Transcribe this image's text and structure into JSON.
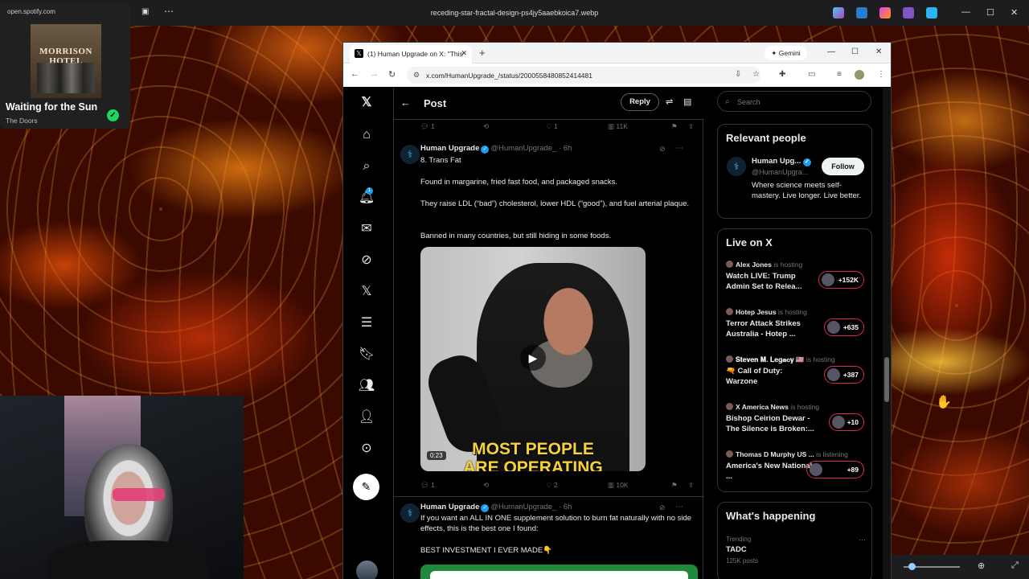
{
  "os": {
    "window_title": "receding-star-fractal-design-ps4jy5aaebkoica7.webp",
    "spotify_url": "open.spotify.com"
  },
  "spotify": {
    "album_text": "MORRISON HOTEL",
    "song": "Waiting for the Sun",
    "artist": "The Doors"
  },
  "browser": {
    "tab_title": "(1) Human Upgrade on X: \"This",
    "gemini_label": "Gemini",
    "url": "x.com/HumanUpgrade_/status/2000558480852414481"
  },
  "x": {
    "header": {
      "title": "Post",
      "reply_label": "Reply"
    },
    "notification_count": "1",
    "top_actions": {
      "replies": "1",
      "likes": "1",
      "views": "11K"
    },
    "tweet1": {
      "name": "Human Upgrade",
      "handle": "@HumanUpgrade_ · 6h",
      "lines": [
        "8. Trans Fat",
        "Found in margarine, fried fast food, and packaged snacks.",
        "They raise LDL (“bad”) cholesterol, lower HDL (“good”), and fuel arterial plaque.",
        "Banned in many countries, but still hiding in some foods."
      ],
      "video": {
        "caption_line1": "MOST PEOPLE",
        "caption_line2": "ARE OPERATING",
        "duration": "0:23"
      },
      "actions": {
        "replies": "1",
        "likes": "2",
        "views": "10K"
      }
    },
    "tweet2": {
      "name": "Human Upgrade",
      "handle": "@HumanUpgrade_ · 6h",
      "text": "If you want an ALL IN ONE supplement solution to burn fat naturally with no side effects, this is the best one I found:",
      "text2": "BEST INVESTMENT I EVER MADE👇"
    },
    "search_placeholder": "Search",
    "relevant": {
      "title": "Relevant people",
      "name": "Human Upg...",
      "handle": "@HumanUpgra...",
      "bio": "Where science meets self-mastery. Live longer. Live better.",
      "follow_label": "Follow"
    },
    "live": {
      "title": "Live on X",
      "items": [
        {
          "host": "Alex Jones",
          "status": "is hosting",
          "title": "Watch LIVE: Trump Admin Set to Relea...",
          "count": "+152K"
        },
        {
          "host": "Hotep Jesus",
          "status": "is hosting",
          "title": "Terror Attack Strikes Australia - Hotep ...",
          "count": "+635"
        },
        {
          "host": "𝐒𝐭𝐞𝐯𝐞𝐧 𝐌. 𝐋𝐞𝐠𝐚𝐜𝐲 🇺🇸",
          "status": "is hosting",
          "title": "🔫 Call of Duty: Warzone",
          "count": "+387"
        },
        {
          "host": "X America News",
          "status": "is hosting",
          "title": "Bishop Ceirion Dewar - The Silence is Broken:...",
          "count": "+10"
        },
        {
          "host": "Thomas D Murphy US ...",
          "status": "is listening",
          "title": "America's New National ...",
          "count": "+89"
        }
      ]
    },
    "happening": {
      "title": "What's happening",
      "trend_label": "Trending",
      "trend_name": "TADC",
      "trend_count": "125K posts"
    }
  }
}
